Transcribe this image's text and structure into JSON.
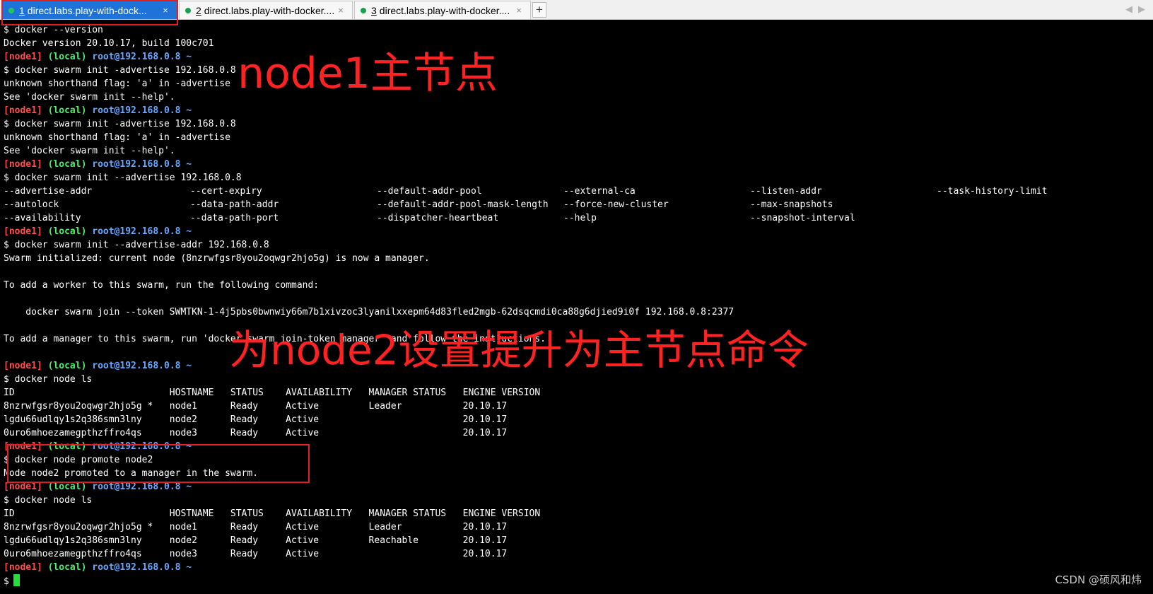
{
  "tabs": [
    {
      "num": "1",
      "title": "direct.labs.play-with-dock...",
      "active": true
    },
    {
      "num": "2",
      "title": "direct.labs.play-with-docker....",
      "active": false
    },
    {
      "num": "3",
      "title": "direct.labs.play-with-docker....",
      "active": false
    }
  ],
  "icons": {
    "close": "×",
    "add": "+",
    "prev": "◀",
    "next": "▶"
  },
  "prompt": {
    "node": "[node1]",
    "loc": "(local)",
    "host": "root@192.168.0.8 ~"
  },
  "lines": {
    "l1": "$ docker --version",
    "l2": "Docker version 20.10.17, build 100c701",
    "l3": "$ docker swarm init -advertise 192.168.0.8",
    "l4": "unknown shorthand flag: 'a' in -advertise",
    "l5": "See 'docker swarm init --help'.",
    "l6": "$ docker swarm init -advertise 192.168.0.8",
    "l7": "unknown shorthand flag: 'a' in -advertise",
    "l8": "See 'docker swarm init --help'.",
    "l9": "$ docker swarm init --advertise 192.168.0.8",
    "l10": "$ docker swarm init --advertise-addr 192.168.0.8",
    "l11": "Swarm initialized: current node (8nzrwfgsr8you2oqwgr2hjo5g) is now a manager.",
    "l12": "To add a worker to this swarm, run the following command:",
    "l13": "    docker swarm join --token SWMTKN-1-4j5pbs0bwnwiy66m7b1xivzoc3lyanilxxepm64d83fled2mgb-62dsqcmdi0ca88g6djied9i0f 192.168.0.8:2377",
    "l14": "To add a manager to this swarm, run 'docker swarm join-token manager' and follow the instructions.",
    "l15": "$ docker node ls",
    "l16": "$ docker node promote node2",
    "l17": "Node node2 promoted to a manager in the swarm.",
    "l18": "$ docker node ls",
    "l19": "$"
  },
  "completions": [
    [
      "--advertise-addr",
      "--cert-expiry",
      "--default-addr-pool",
      "--external-ca",
      "--listen-addr",
      "--task-history-limit"
    ],
    [
      "--autolock",
      "--data-path-addr",
      "--default-addr-pool-mask-length",
      "--force-new-cluster",
      "--max-snapshots",
      ""
    ],
    [
      "--availability",
      "--data-path-port",
      "--dispatcher-heartbeat",
      "--help",
      "--snapshot-interval",
      ""
    ]
  ],
  "table1": [
    "ID                            HOSTNAME   STATUS    AVAILABILITY   MANAGER STATUS   ENGINE VERSION",
    "8nzrwfgsr8you2oqwgr2hjo5g *   node1      Ready     Active         Leader           20.10.17",
    "lgdu66udlqy1s2q386smn3lny     node2      Ready     Active                          20.10.17",
    "0uro6mhoezamegpthzffro4qs     node3      Ready     Active                          20.10.17"
  ],
  "table2": [
    "ID                            HOSTNAME   STATUS    AVAILABILITY   MANAGER STATUS   ENGINE VERSION",
    "8nzrwfgsr8you2oqwgr2hjo5g *   node1      Ready     Active         Leader           20.10.17",
    "lgdu66udlqy1s2q386smn3lny     node2      Ready     Active         Reachable        20.10.17",
    "0uro6mhoezamegpthzffro4qs     node3      Ready     Active                          20.10.17"
  ],
  "annotations": {
    "a1": "node1主节点",
    "a2": "为node2设置提升为主节点命令"
  },
  "watermark": "CSDN @硕风和炜",
  "colors": {
    "tab_active": "#1e72d8",
    "prompt_node": "#ff4d4d",
    "prompt_local": "#4ef06a",
    "prompt_host": "#66a8ff",
    "cursor": "#22e23a",
    "annotation": "#ff2222"
  }
}
